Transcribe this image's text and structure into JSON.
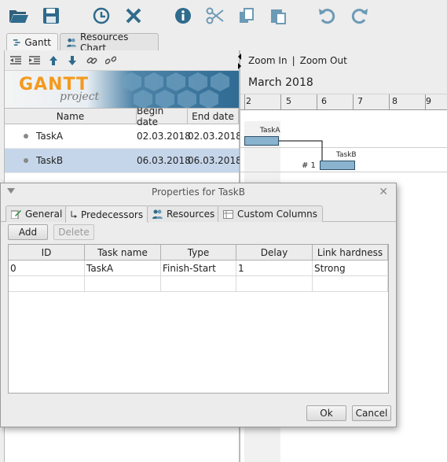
{
  "toolbar": {
    "icons": [
      "open-folder-icon",
      "save-icon",
      "history-clock-icon",
      "delete-x-icon",
      "info-icon",
      "cut-scissors-icon",
      "copy-icon",
      "paste-icon",
      "undo-icon",
      "redo-icon"
    ]
  },
  "main_tabs": [
    {
      "label": "Gantt"
    },
    {
      "label": "Resources Chart"
    }
  ],
  "logo": {
    "brand": "GANTT",
    "sub": "project"
  },
  "task_table": {
    "headers": {
      "name": "Name",
      "begin": "Begin date",
      "end": "End date"
    },
    "rows": [
      {
        "name": "TaskA",
        "begin": "02.03.2018",
        "end": "02.03.2018",
        "selected": false
      },
      {
        "name": "TaskB",
        "begin": "06.03.2018",
        "end": "06.03.2018",
        "selected": true
      }
    ]
  },
  "chart": {
    "zoom_in": "Zoom In",
    "separator": "|",
    "zoom_out": "Zoom Out",
    "month": "March 2018",
    "days": [
      "2",
      "5",
      "6",
      "7",
      "8",
      "9"
    ],
    "taskA_label": "TaskA",
    "taskB_label": "TaskB",
    "dependency_label": "# 1",
    "bar_color": "#8ab3cf"
  },
  "dialog": {
    "title": "Properties for TaskB",
    "tabs": [
      {
        "label": "General"
      },
      {
        "label": "Predecessors"
      },
      {
        "label": "Resources"
      },
      {
        "label": "Custom Columns"
      }
    ],
    "add_label": "Add",
    "delete_label": "Delete",
    "table": {
      "headers": [
        "ID",
        "Task name",
        "Type",
        "Delay",
        "Link hardness"
      ],
      "rows": [
        [
          "0",
          "TaskA",
          "Finish-Start",
          "1",
          "Strong"
        ]
      ]
    },
    "ok_label": "Ok",
    "cancel_label": "Cancel"
  }
}
